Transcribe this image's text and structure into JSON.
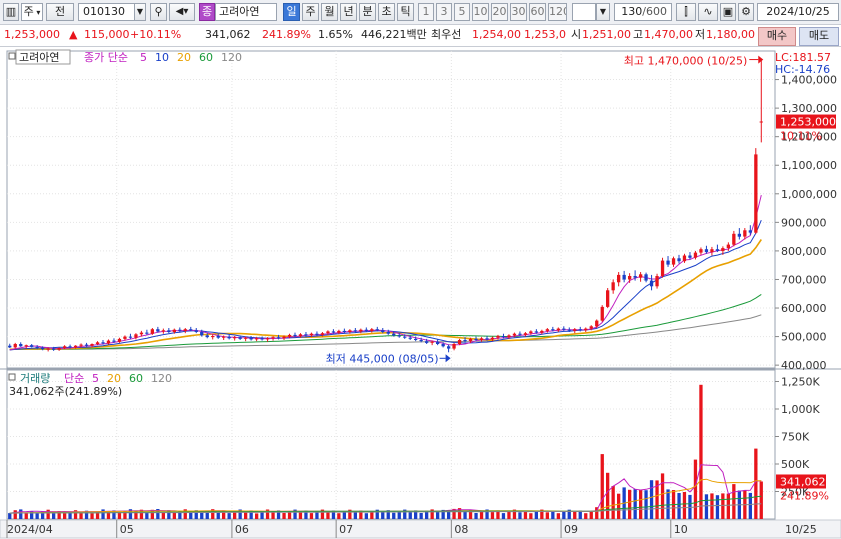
{
  "toolbar": {
    "market": "주",
    "market_mode": "전",
    "code": "010130",
    "name_badge": "종",
    "name": "고려아연",
    "periods": [
      "일",
      "주",
      "월",
      "년",
      "분",
      "초",
      "틱"
    ],
    "intervals": [
      "1",
      "3",
      "5",
      "10",
      "20",
      "30",
      "60",
      "120"
    ],
    "count": "130",
    "count_total": "/600",
    "date": "2024/10/25"
  },
  "quote": {
    "price": "1,253,000",
    "change_arrow": "▲",
    "change": "115,000",
    "change_pct": "+10.11%",
    "volume": "341,062",
    "volume_ratio": "241.89%",
    "turnover_pct": "1.65%",
    "amount": "446,221백만",
    "best_label": "최우선",
    "best_ask": "1,254,00",
    "best_bid": "1,253,0",
    "open_label": "시",
    "open": "1,251,00",
    "high_label": "고",
    "high": "1,470,00",
    "low_label": "저",
    "low": "1,180,00",
    "buy_label": "매수",
    "sell_label": "매도"
  },
  "colors": {
    "up": "#e8141b",
    "down": "#1a40c8",
    "ma5": "#c020c0",
    "ma10": "#1a40c8",
    "ma20": "#e8a000",
    "ma60": "#1a9a3a",
    "ma120": "#888888",
    "grid": "#e4e4e4"
  },
  "chart_data": [
    {
      "type": "candlestick",
      "panel": "price",
      "legend": {
        "name": "고려아연",
        "prefix": "종가 단순",
        "periods": [
          "5",
          "10",
          "20",
          "60",
          "120"
        ]
      },
      "lc_label": "LC:181.57",
      "hc_label": "HC:-14.76",
      "ylim": [
        390000,
        1500000
      ],
      "y_ticks": [
        400000,
        500000,
        600000,
        700000,
        800000,
        900000,
        1000000,
        1100000,
        1200000,
        1300000,
        1400000
      ],
      "y_tick_labels": [
        "400,000",
        "500,000",
        "600,000",
        "700,000",
        "800,000",
        "900,000",
        "1,000,000",
        "1,100,000",
        "1,200,000",
        "1,300,000",
        "1,400,000"
      ],
      "current_price_label": "1,253,000",
      "current_pct_label": "10.11%",
      "current_price": 1253000,
      "annotations": [
        {
          "text": "최고 1,470,000 (10/25)",
          "value": 1470000,
          "date": "10/25",
          "kind": "high"
        },
        {
          "text": "최저 445,000 (08/05)",
          "value": 445000,
          "date": "08/05",
          "kind": "low"
        }
      ],
      "x_month_labels": [
        "2024/04",
        "05",
        "06",
        "07",
        "08",
        "09",
        "10"
      ],
      "x_month_starts": [
        0,
        20,
        41,
        60,
        81,
        101,
        121
      ],
      "x_end_label": "10/25",
      "candles": [
        {
          "o": 468000,
          "h": 475000,
          "l": 460000,
          "c": 462000
        },
        {
          "o": 462000,
          "h": 478000,
          "l": 458000,
          "c": 474000
        },
        {
          "o": 474000,
          "h": 480000,
          "l": 464000,
          "c": 466000
        },
        {
          "o": 466000,
          "h": 472000,
          "l": 458000,
          "c": 470000
        },
        {
          "o": 470000,
          "h": 474000,
          "l": 462000,
          "c": 464000
        },
        {
          "o": 464000,
          "h": 470000,
          "l": 456000,
          "c": 460000
        },
        {
          "o": 460000,
          "h": 466000,
          "l": 452000,
          "c": 456000
        },
        {
          "o": 456000,
          "h": 462000,
          "l": 448000,
          "c": 458000
        },
        {
          "o": 458000,
          "h": 464000,
          "l": 450000,
          "c": 454000
        },
        {
          "o": 454000,
          "h": 462000,
          "l": 450000,
          "c": 460000
        },
        {
          "o": 460000,
          "h": 470000,
          "l": 456000,
          "c": 466000
        },
        {
          "o": 466000,
          "h": 472000,
          "l": 458000,
          "c": 462000
        },
        {
          "o": 462000,
          "h": 470000,
          "l": 458000,
          "c": 468000
        },
        {
          "o": 468000,
          "h": 476000,
          "l": 462000,
          "c": 472000
        },
        {
          "o": 472000,
          "h": 478000,
          "l": 464000,
          "c": 468000
        },
        {
          "o": 468000,
          "h": 476000,
          "l": 462000,
          "c": 474000
        },
        {
          "o": 474000,
          "h": 484000,
          "l": 470000,
          "c": 480000
        },
        {
          "o": 480000,
          "h": 488000,
          "l": 472000,
          "c": 476000
        },
        {
          "o": 476000,
          "h": 490000,
          "l": 472000,
          "c": 486000
        },
        {
          "o": 486000,
          "h": 494000,
          "l": 478000,
          "c": 482000
        },
        {
          "o": 482000,
          "h": 496000,
          "l": 478000,
          "c": 492000
        },
        {
          "o": 492000,
          "h": 504000,
          "l": 486000,
          "c": 500000
        },
        {
          "o": 500000,
          "h": 510000,
          "l": 492000,
          "c": 496000
        },
        {
          "o": 496000,
          "h": 512000,
          "l": 490000,
          "c": 508000
        },
        {
          "o": 508000,
          "h": 520000,
          "l": 500000,
          "c": 514000
        },
        {
          "o": 514000,
          "h": 524000,
          "l": 506000,
          "c": 510000
        },
        {
          "o": 510000,
          "h": 530000,
          "l": 506000,
          "c": 526000
        },
        {
          "o": 526000,
          "h": 534000,
          "l": 514000,
          "c": 518000
        },
        {
          "o": 518000,
          "h": 528000,
          "l": 510000,
          "c": 522000
        },
        {
          "o": 522000,
          "h": 530000,
          "l": 512000,
          "c": 516000
        },
        {
          "o": 516000,
          "h": 528000,
          "l": 510000,
          "c": 524000
        },
        {
          "o": 524000,
          "h": 532000,
          "l": 516000,
          "c": 520000
        },
        {
          "o": 520000,
          "h": 530000,
          "l": 512000,
          "c": 526000
        },
        {
          "o": 526000,
          "h": 534000,
          "l": 518000,
          "c": 522000
        },
        {
          "o": 522000,
          "h": 530000,
          "l": 512000,
          "c": 516000
        },
        {
          "o": 516000,
          "h": 524000,
          "l": 500000,
          "c": 504000
        },
        {
          "o": 504000,
          "h": 512000,
          "l": 494000,
          "c": 498000
        },
        {
          "o": 498000,
          "h": 508000,
          "l": 490000,
          "c": 502000
        },
        {
          "o": 502000,
          "h": 510000,
          "l": 492000,
          "c": 496000
        },
        {
          "o": 496000,
          "h": 504000,
          "l": 488000,
          "c": 500000
        },
        {
          "o": 500000,
          "h": 506000,
          "l": 490000,
          "c": 494000
        },
        {
          "o": 494000,
          "h": 502000,
          "l": 486000,
          "c": 498000
        },
        {
          "o": 498000,
          "h": 504000,
          "l": 488000,
          "c": 492000
        },
        {
          "o": 492000,
          "h": 500000,
          "l": 484000,
          "c": 496000
        },
        {
          "o": 496000,
          "h": 502000,
          "l": 486000,
          "c": 490000
        },
        {
          "o": 490000,
          "h": 498000,
          "l": 484000,
          "c": 494000
        },
        {
          "o": 494000,
          "h": 500000,
          "l": 486000,
          "c": 490000
        },
        {
          "o": 490000,
          "h": 498000,
          "l": 482000,
          "c": 494000
        },
        {
          "o": 494000,
          "h": 502000,
          "l": 486000,
          "c": 498000
        },
        {
          "o": 498000,
          "h": 506000,
          "l": 490000,
          "c": 494000
        },
        {
          "o": 494000,
          "h": 504000,
          "l": 488000,
          "c": 500000
        },
        {
          "o": 500000,
          "h": 510000,
          "l": 494000,
          "c": 506000
        },
        {
          "o": 506000,
          "h": 514000,
          "l": 498000,
          "c": 502000
        },
        {
          "o": 502000,
          "h": 512000,
          "l": 496000,
          "c": 508000
        },
        {
          "o": 508000,
          "h": 516000,
          "l": 500000,
          "c": 504000
        },
        {
          "o": 504000,
          "h": 514000,
          "l": 498000,
          "c": 510000
        },
        {
          "o": 510000,
          "h": 518000,
          "l": 502000,
          "c": 506000
        },
        {
          "o": 506000,
          "h": 516000,
          "l": 500000,
          "c": 512000
        },
        {
          "o": 512000,
          "h": 522000,
          "l": 506000,
          "c": 518000
        },
        {
          "o": 518000,
          "h": 526000,
          "l": 510000,
          "c": 514000
        },
        {
          "o": 514000,
          "h": 524000,
          "l": 508000,
          "c": 520000
        },
        {
          "o": 520000,
          "h": 528000,
          "l": 512000,
          "c": 516000
        },
        {
          "o": 516000,
          "h": 526000,
          "l": 510000,
          "c": 522000
        },
        {
          "o": 522000,
          "h": 530000,
          "l": 514000,
          "c": 518000
        },
        {
          "o": 518000,
          "h": 528000,
          "l": 512000,
          "c": 524000
        },
        {
          "o": 524000,
          "h": 532000,
          "l": 516000,
          "c": 520000
        },
        {
          "o": 520000,
          "h": 530000,
          "l": 514000,
          "c": 526000
        },
        {
          "o": 526000,
          "h": 534000,
          "l": 518000,
          "c": 522000
        },
        {
          "o": 522000,
          "h": 530000,
          "l": 512000,
          "c": 516000
        },
        {
          "o": 516000,
          "h": 524000,
          "l": 506000,
          "c": 510000
        },
        {
          "o": 510000,
          "h": 518000,
          "l": 500000,
          "c": 504000
        },
        {
          "o": 504000,
          "h": 512000,
          "l": 496000,
          "c": 500000
        },
        {
          "o": 500000,
          "h": 508000,
          "l": 492000,
          "c": 496000
        },
        {
          "o": 496000,
          "h": 504000,
          "l": 488000,
          "c": 492000
        },
        {
          "o": 492000,
          "h": 500000,
          "l": 484000,
          "c": 488000
        },
        {
          "o": 488000,
          "h": 496000,
          "l": 480000,
          "c": 484000
        },
        {
          "o": 484000,
          "h": 492000,
          "l": 474000,
          "c": 478000
        },
        {
          "o": 478000,
          "h": 486000,
          "l": 470000,
          "c": 482000
        },
        {
          "o": 482000,
          "h": 490000,
          "l": 470000,
          "c": 474000
        },
        {
          "o": 474000,
          "h": 480000,
          "l": 462000,
          "c": 466000
        },
        {
          "o": 466000,
          "h": 472000,
          "l": 445000,
          "c": 458000
        },
        {
          "o": 458000,
          "h": 478000,
          "l": 452000,
          "c": 474000
        },
        {
          "o": 474000,
          "h": 492000,
          "l": 470000,
          "c": 488000
        },
        {
          "o": 488000,
          "h": 498000,
          "l": 480000,
          "c": 484000
        },
        {
          "o": 484000,
          "h": 496000,
          "l": 478000,
          "c": 492000
        },
        {
          "o": 492000,
          "h": 500000,
          "l": 484000,
          "c": 488000
        },
        {
          "o": 488000,
          "h": 498000,
          "l": 482000,
          "c": 494000
        },
        {
          "o": 494000,
          "h": 502000,
          "l": 486000,
          "c": 490000
        },
        {
          "o": 490000,
          "h": 500000,
          "l": 484000,
          "c": 496000
        },
        {
          "o": 496000,
          "h": 506000,
          "l": 490000,
          "c": 502000
        },
        {
          "o": 502000,
          "h": 510000,
          "l": 494000,
          "c": 498000
        },
        {
          "o": 498000,
          "h": 508000,
          "l": 492000,
          "c": 504000
        },
        {
          "o": 504000,
          "h": 514000,
          "l": 498000,
          "c": 510000
        },
        {
          "o": 510000,
          "h": 518000,
          "l": 502000,
          "c": 506000
        },
        {
          "o": 506000,
          "h": 516000,
          "l": 500000,
          "c": 512000
        },
        {
          "o": 512000,
          "h": 522000,
          "l": 506000,
          "c": 518000
        },
        {
          "o": 518000,
          "h": 526000,
          "l": 510000,
          "c": 514000
        },
        {
          "o": 514000,
          "h": 524000,
          "l": 508000,
          "c": 520000
        },
        {
          "o": 520000,
          "h": 530000,
          "l": 514000,
          "c": 526000
        },
        {
          "o": 526000,
          "h": 534000,
          "l": 518000,
          "c": 522000
        },
        {
          "o": 522000,
          "h": 532000,
          "l": 516000,
          "c": 528000
        },
        {
          "o": 528000,
          "h": 536000,
          "l": 520000,
          "c": 524000
        },
        {
          "o": 524000,
          "h": 532000,
          "l": 516000,
          "c": 520000
        },
        {
          "o": 520000,
          "h": 530000,
          "l": 512000,
          "c": 526000
        },
        {
          "o": 526000,
          "h": 534000,
          "l": 518000,
          "c": 522000
        },
        {
          "o": 522000,
          "h": 532000,
          "l": 516000,
          "c": 528000
        },
        {
          "o": 528000,
          "h": 540000,
          "l": 522000,
          "c": 536000
        },
        {
          "o": 536000,
          "h": 560000,
          "l": 530000,
          "c": 556000
        },
        {
          "o": 556000,
          "h": 610000,
          "l": 552000,
          "c": 604000
        },
        {
          "o": 604000,
          "h": 670000,
          "l": 600000,
          "c": 662000
        },
        {
          "o": 662000,
          "h": 700000,
          "l": 650000,
          "c": 690000
        },
        {
          "o": 690000,
          "h": 726000,
          "l": 676000,
          "c": 716000
        },
        {
          "o": 716000,
          "h": 730000,
          "l": 690000,
          "c": 700000
        },
        {
          "o": 700000,
          "h": 722000,
          "l": 688000,
          "c": 712000
        },
        {
          "o": 712000,
          "h": 732000,
          "l": 696000,
          "c": 706000
        },
        {
          "o": 706000,
          "h": 726000,
          "l": 692000,
          "c": 718000
        },
        {
          "o": 718000,
          "h": 724000,
          "l": 690000,
          "c": 696000
        },
        {
          "o": 696000,
          "h": 716000,
          "l": 662000,
          "c": 676000
        },
        {
          "o": 676000,
          "h": 720000,
          "l": 668000,
          "c": 712000
        },
        {
          "o": 712000,
          "h": 776000,
          "l": 706000,
          "c": 766000
        },
        {
          "o": 766000,
          "h": 782000,
          "l": 744000,
          "c": 752000
        },
        {
          "o": 752000,
          "h": 780000,
          "l": 744000,
          "c": 774000
        },
        {
          "o": 774000,
          "h": 786000,
          "l": 756000,
          "c": 764000
        },
        {
          "o": 764000,
          "h": 790000,
          "l": 758000,
          "c": 784000
        },
        {
          "o": 784000,
          "h": 796000,
          "l": 770000,
          "c": 776000
        },
        {
          "o": 776000,
          "h": 800000,
          "l": 770000,
          "c": 794000
        },
        {
          "o": 794000,
          "h": 812000,
          "l": 786000,
          "c": 806000
        },
        {
          "o": 806000,
          "h": 818000,
          "l": 790000,
          "c": 796000
        },
        {
          "o": 796000,
          "h": 814000,
          "l": 784000,
          "c": 806000
        },
        {
          "o": 806000,
          "h": 822000,
          "l": 796000,
          "c": 800000
        },
        {
          "o": 800000,
          "h": 816000,
          "l": 786000,
          "c": 810000
        },
        {
          "o": 810000,
          "h": 830000,
          "l": 800000,
          "c": 822000
        },
        {
          "o": 822000,
          "h": 870000,
          "l": 816000,
          "c": 860000
        },
        {
          "o": 860000,
          "h": 880000,
          "l": 840000,
          "c": 850000
        },
        {
          "o": 850000,
          "h": 880000,
          "l": 840000,
          "c": 872000
        },
        {
          "o": 872000,
          "h": 890000,
          "l": 856000,
          "c": 864000
        },
        {
          "o": 864000,
          "h": 1160000,
          "l": 860000,
          "c": 1138000
        },
        {
          "o": 1251000,
          "h": 1470000,
          "l": 1180000,
          "c": 1253000
        }
      ]
    },
    {
      "type": "bar",
      "panel": "volume",
      "legend": {
        "name": "거래량",
        "prefix": "단순",
        "periods": [
          "5",
          "20",
          "60",
          "120"
        ]
      },
      "value_label": "341,062주(241.89%)",
      "ylim": [
        0,
        1300000
      ],
      "y_ticks": [
        250000,
        500000,
        750000,
        1000000,
        1250000
      ],
      "y_tick_labels": [
        "250K",
        "500K",
        "750K",
        "1,000K",
        "1,250K"
      ],
      "current_volume_label": "341,062",
      "current_ratio_label": "241.89%",
      "current_volume": 341062
    }
  ]
}
